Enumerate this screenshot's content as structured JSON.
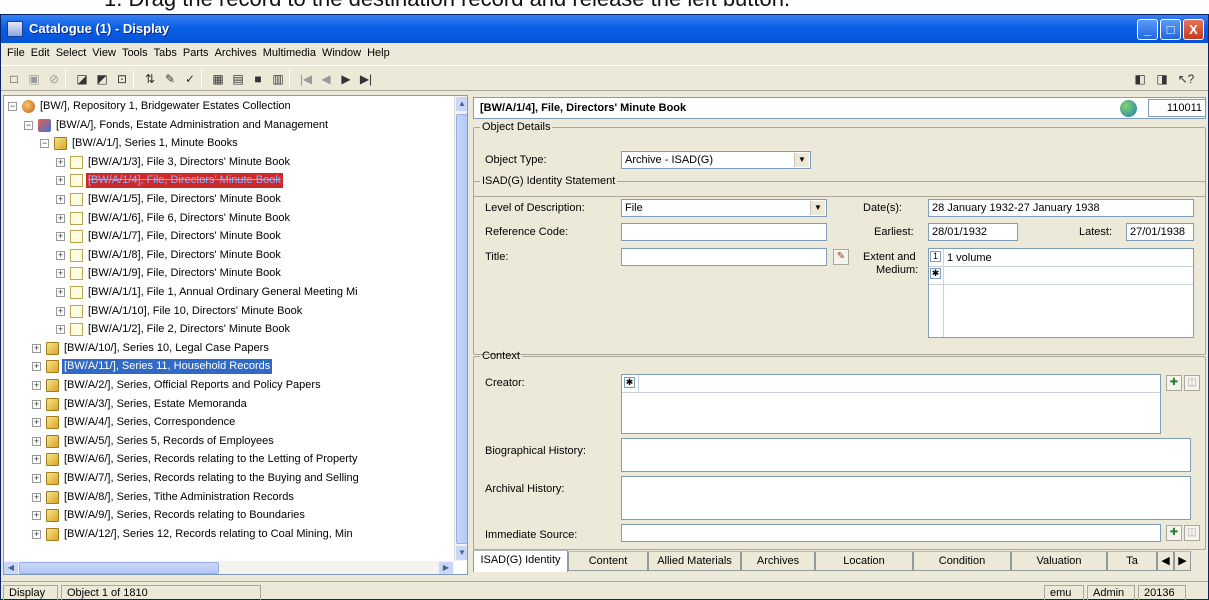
{
  "doc_heading": "1.     Drag the record to the destination record and release the left button.",
  "window": {
    "title": "Catalogue (1) - Display",
    "controls": {
      "minimize": "_",
      "maximize": "□",
      "close": "X"
    }
  },
  "menu": [
    "File",
    "Edit",
    "Select",
    "View",
    "Tools",
    "Tabs",
    "Parts",
    "Archives",
    "Multimedia",
    "Window",
    "Help"
  ],
  "toolbar": {
    "icons": [
      "new-icon",
      "save-icon",
      "stop-icon",
      "page-icon",
      "page-icon",
      "page-icon",
      "sort-icon",
      "edit-icon",
      "spell-icon",
      "view-icon",
      "view-icon",
      "view-icon",
      "view-icon",
      "first-icon",
      "prev-icon",
      "next-icon",
      "last-icon",
      "record-icon",
      "record-icon",
      "help-icon"
    ],
    "glyphs": {
      "nav_first": "|◀",
      "nav_prev": "◀",
      "nav_next": "▶",
      "nav_last": "▶|"
    }
  },
  "tree": {
    "items": [
      {
        "expander": "−",
        "icon": "repository-icon",
        "label": "[BW/], Repository 1, Bridgewater Estates Collection"
      },
      {
        "expander": "−",
        "icon": "fonds-icon",
        "label": "[BW/A/], Fonds, Estate Administration and Management"
      },
      {
        "expander": "−",
        "icon": "folder-icon",
        "label": "[BW/A/1/], Series 1, Minute Books"
      },
      {
        "expander": "+",
        "icon": "document-icon",
        "label": "[BW/A/1/3], File 3, Directors' Minute Book"
      },
      {
        "expander": "+",
        "icon": "document-icon",
        "label": "[BW/A/1/4], File, Directors' Minute Book",
        "state": "dragging"
      },
      {
        "expander": "+",
        "icon": "document-icon",
        "label": "[BW/A/1/5], File, Directors' Minute Book"
      },
      {
        "expander": "+",
        "icon": "document-icon",
        "label": "[BW/A/1/6], File 6, Directors' Minute Book"
      },
      {
        "expander": "+",
        "icon": "document-icon",
        "label": "[BW/A/1/7], File, Directors' Minute Book"
      },
      {
        "expander": "+",
        "icon": "document-icon",
        "label": "[BW/A/1/8], File, Directors' Minute Book"
      },
      {
        "expander": "+",
        "icon": "document-icon",
        "label": "[BW/A/1/9], File, Directors' Minute Book"
      },
      {
        "expander": "+",
        "icon": "document-icon",
        "label": "[BW/A/1/1], File 1, Annual Ordinary General Meeting Mi"
      },
      {
        "expander": "+",
        "icon": "document-icon",
        "label": "[BW/A/1/10], File 10, Directors' Minute Book"
      },
      {
        "expander": "+",
        "icon": "document-icon",
        "label": "[BW/A/1/2], File 2, Directors' Minute Book"
      },
      {
        "expander": "+",
        "icon": "folder-icon",
        "label": "[BW/A/10/], Series 10, Legal Case Papers"
      },
      {
        "expander": "+",
        "icon": "folder-icon",
        "label": "[BW/A/11/], Series 11, Household Records",
        "state": "drop-target"
      },
      {
        "expander": "+",
        "icon": "folder-icon",
        "label": "[BW/A/2/], Series, Official Reports and Policy Papers"
      },
      {
        "expander": "+",
        "icon": "folder-icon",
        "label": "[BW/A/3/], Series, Estate Memoranda"
      },
      {
        "expander": "+",
        "icon": "folder-icon",
        "label": "[BW/A/4/], Series, Correspondence"
      },
      {
        "expander": "+",
        "icon": "folder-icon",
        "label": "[BW/A/5/], Series 5, Records of Employees"
      },
      {
        "expander": "+",
        "icon": "folder-icon",
        "label": "[BW/A/6/], Series, Records relating to the Letting of Property"
      },
      {
        "expander": "+",
        "icon": "folder-icon",
        "label": "[BW/A/7/], Series, Records relating to the Buying and Selling"
      },
      {
        "expander": "+",
        "icon": "folder-icon",
        "label": "[BW/A/8/], Series, Tithe Administration Records"
      },
      {
        "expander": "+",
        "icon": "folder-icon",
        "label": "[BW/A/9/], Series, Records relating to Boundaries"
      },
      {
        "expander": "+",
        "icon": "folder-icon",
        "label": "[BW/A/12/], Series 12, Records relating to Coal Mining, Min"
      }
    ]
  },
  "record": {
    "header_title": "[BW/A/1/4], File, Directors' Minute Book",
    "irn": "110011",
    "object_details": {
      "legend": "Object Details",
      "object_type_label": "Object Type:",
      "object_type_value": "Archive - ISAD(G)"
    },
    "identity": {
      "legend": "ISAD(G) Identity Statement",
      "level_label": "Level of Description:",
      "level_value": "File",
      "reference_label": "Reference Code:",
      "reference_value": "",
      "title_label": "Title:",
      "title_value": "",
      "dates_label": "Date(s):",
      "dates_value": "28 January 1932-27 January 1938",
      "earliest_label": "Earliest:",
      "earliest_value": "28/01/1932",
      "latest_label": "Latest:",
      "latest_value": "27/01/1938",
      "extent_label_1": "Extent and",
      "extent_label_2": "Medium:",
      "extent_rows": [
        {
          "num": "1",
          "value": "1 volume"
        },
        {
          "num": "✱",
          "value": ""
        }
      ]
    },
    "context": {
      "legend": "Context",
      "creator_label": "Creator:",
      "creator_marker": "✱",
      "bio_label": "Biographical History:",
      "archival_label": "Archival History:",
      "immediate_label": "Immediate Source:"
    },
    "tabs": [
      "ISAD(G) Identity",
      "Content",
      "Allied Materials",
      "Archives",
      "Location",
      "Condition",
      "Valuation",
      "Ta"
    ],
    "tab_scroll": {
      "left": "◀",
      "right": "▶"
    }
  },
  "status": {
    "mode": "Display",
    "object_count": "Object 1 of 1810",
    "user": "emu",
    "group": "Admin",
    "number": "20136"
  }
}
